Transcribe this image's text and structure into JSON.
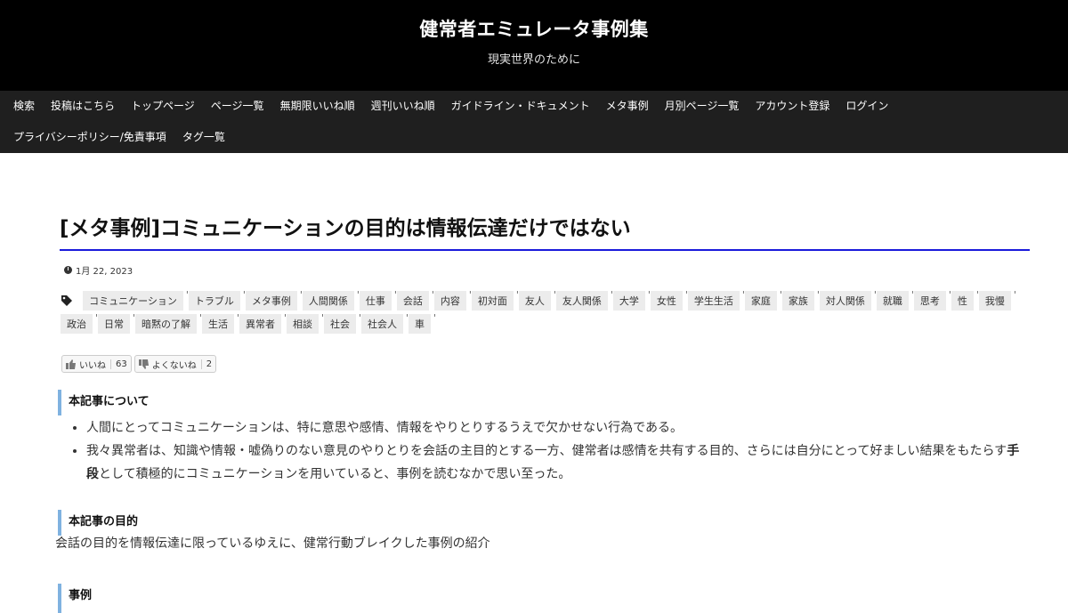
{
  "site": {
    "title": "健常者エミュレータ事例集",
    "description": "現実世界のために"
  },
  "nav": {
    "items": [
      "検索",
      "投稿はこちら",
      "トップページ",
      "ページ一覧",
      "無期限いいね順",
      "週刊いいね順",
      "ガイドライン・ドキュメント",
      "メタ事例",
      "月別ページ一覧",
      "アカウント登録",
      "ログイン",
      "プライバシーポリシー/免責事項",
      "タグ一覧"
    ]
  },
  "article": {
    "title": "[メタ事例]コミュニケーションの目的は情報伝達だけではない",
    "date": "1月 22, 2023",
    "tags": [
      "コミュニケーション",
      "トラブル",
      "メタ事例",
      "人間関係",
      "仕事",
      "会話",
      "内容",
      "初対面",
      "友人",
      "友人関係",
      "大学",
      "女性",
      "学生生活",
      "家庭",
      "家族",
      "対人関係",
      "就職",
      "思考",
      "性",
      "我慢",
      "政治",
      "日常",
      "暗黙の了解",
      "生活",
      "異常者",
      "相談",
      "社会",
      "社会人",
      "車"
    ],
    "votes": {
      "like_label": "いいね",
      "like_count": "63",
      "dislike_label": "よくないね",
      "dislike_count": "2"
    },
    "section_about": "本記事について",
    "bullets": {
      "b1": "人間にとってコミュニケーションは、特に意思や感情、情報をやりとりするうえで欠かせない行為である。",
      "b2_pre": "我々異常者は、知識や情報・嘘偽りのない意見のやりとりを会話の主目的とする一方、健常者は感情を共有する目的、さらには自分にとって好ましい結果をもたらす",
      "b2_bold": "手段",
      "b2_post": "として積極的にコミュニケーションを用いていると、事例を読むなかで思い至った。"
    },
    "section_purpose": "本記事の目的",
    "purpose_text": "会話の目的を情報伝達に限っているゆえに、健常行動ブレイクした事例の紹介",
    "section_example": "事例"
  },
  "colors": {
    "header_bg": "#000000",
    "nav_bg": "#1f1f1f",
    "title_underline": "#1a1adb",
    "heading_bar": "#7fb2e0"
  }
}
